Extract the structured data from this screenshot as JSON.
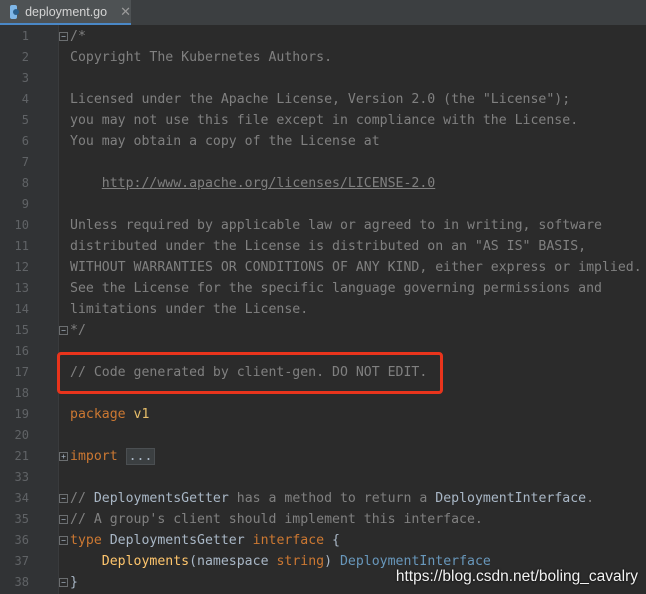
{
  "tab": {
    "label": "deployment.go",
    "close": "✕",
    "icon": "go-file-icon"
  },
  "gutter": {
    "line_numbers": [
      "1",
      "2",
      "3",
      "4",
      "5",
      "6",
      "7",
      "8",
      "9",
      "10",
      "11",
      "12",
      "13",
      "14",
      "15",
      "16",
      "17",
      "18",
      "19",
      "20",
      "21",
      "33",
      "34",
      "35",
      "36",
      "37",
      "38"
    ]
  },
  "code": {
    "l1": "/*",
    "l2": "Copyright The Kubernetes Authors.",
    "l4": "Licensed under the Apache License, Version 2.0 (the \"License\");",
    "l5": "you may not use this file except in compliance with the License.",
    "l6": "You may obtain a copy of the License at",
    "l8_indent": "    ",
    "l8_link": "http://www.apache.org/licenses/LICENSE-2.0",
    "l10": "Unless required by applicable law or agreed to in writing, software",
    "l11": "distributed under the License is distributed on an \"AS IS\" BASIS,",
    "l12": "WITHOUT WARRANTIES OR CONDITIONS OF ANY KIND, either express or implied.",
    "l13": "See the License for the specific language governing permissions and",
    "l14": "limitations under the License.",
    "l15": "*/",
    "l17": "// Code generated by client-gen. DO NOT EDIT.",
    "l19_kw": "package",
    "l19_name": " v1",
    "l21_kw": "import",
    "l21_sp": " ",
    "l21_folded": "...",
    "l34_a": "// ",
    "l34_b": "DeploymentsGetter",
    "l34_c": " has a method to return a ",
    "l34_d": "DeploymentInterface",
    "l34_e": ".",
    "l35": "// A group's client should implement this interface.",
    "l36_kw": "type",
    "l36_name": " DeploymentsGetter ",
    "l36_kw2": "interface",
    "l36_brace": " {",
    "l37_indent": "    ",
    "l37_fn": "Deployments",
    "l37_open": "(namespace ",
    "l37_type": "string",
    "l37_close": ") ",
    "l37_ret": "DeploymentInterface",
    "l38": "}"
  },
  "watermark": "https://blog.csdn.net/boling_cavalry"
}
